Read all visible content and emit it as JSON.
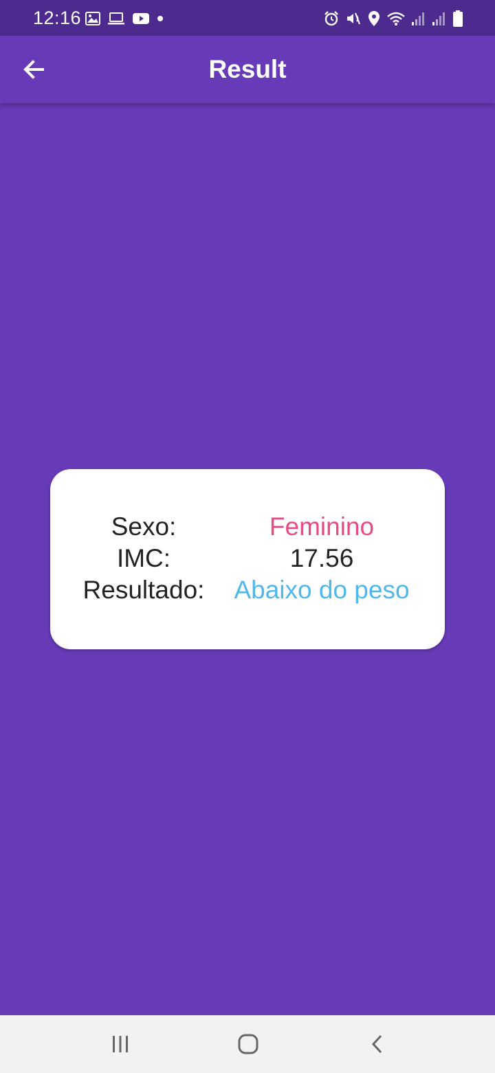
{
  "status_bar": {
    "time": "12:16",
    "left_icons": [
      "gallery-icon",
      "laptop-icon",
      "youtube-icon",
      "dot-icon"
    ],
    "right_icons": [
      "alarm-icon",
      "mute-icon",
      "location-icon",
      "wifi-icon",
      "signal-icon",
      "signal-icon",
      "battery-icon"
    ]
  },
  "app_bar": {
    "title": "Result",
    "back_icon": "arrow-left-icon"
  },
  "result": {
    "rows": [
      {
        "label": "Sexo:",
        "value": "Feminino",
        "value_color": "#e84a86"
      },
      {
        "label": "IMC:",
        "value": "17.56",
        "value_color": "#222222"
      },
      {
        "label": "Resultado:",
        "value": "Abaixo do peso",
        "value_color": "#4fb8e8"
      }
    ]
  },
  "nav_bar": {
    "buttons": [
      "recent-apps-icon",
      "home-icon",
      "back-icon"
    ]
  },
  "colors": {
    "primary": "#673ab7",
    "status_bar": "#4c2a8e",
    "card": "#ffffff",
    "nav_bar": "#f2f2f2"
  }
}
